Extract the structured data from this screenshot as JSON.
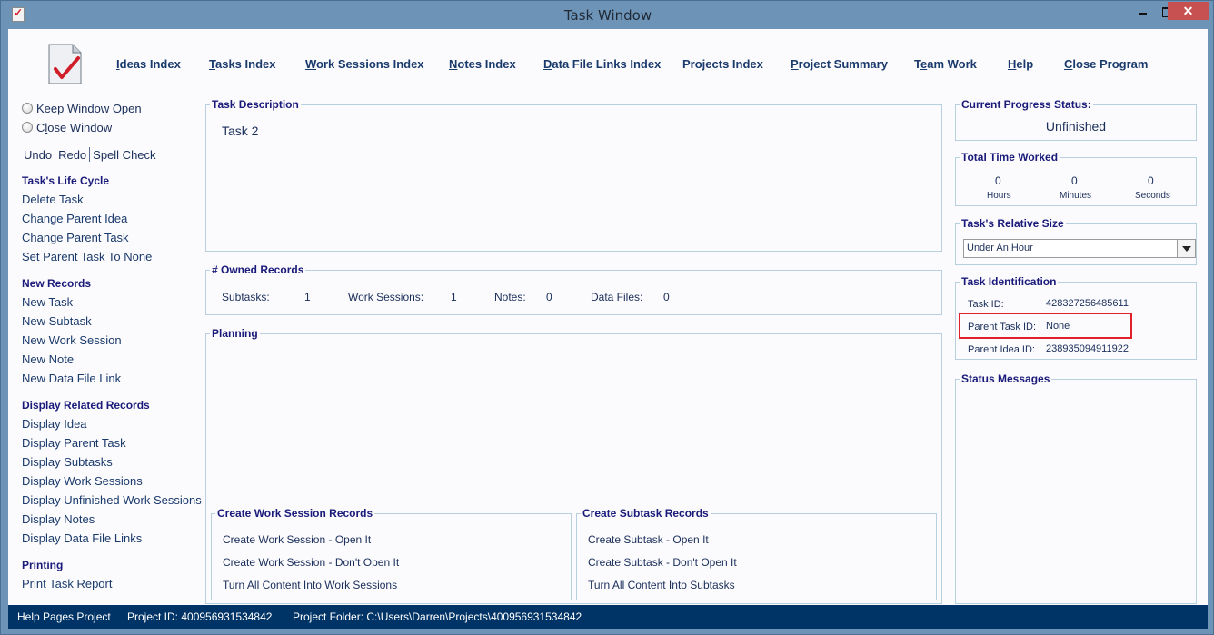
{
  "window": {
    "title": "Task Window",
    "controls": {
      "minimize": "minimize",
      "maximize": "maximize",
      "close": "✕"
    }
  },
  "nav": [
    {
      "label": "Ideas Index",
      "mnemonic": "I",
      "rest": "deas Index"
    },
    {
      "label": "Tasks Index",
      "mnemonic": "T",
      "rest": "asks Index"
    },
    {
      "label": "Work Sessions Index",
      "mnemonic": "W",
      "rest": "ork Sessions Index"
    },
    {
      "label": "Notes Index",
      "mnemonic": "N",
      "rest": "otes Index"
    },
    {
      "label": "Data File Links Index",
      "mnemonic": "D",
      "rest": "ata File Links Index"
    },
    {
      "label": "Projects Index",
      "mnemonic": "",
      "rest": "Projects Index"
    },
    {
      "label": "Project Summary",
      "mnemonic": "P",
      "rest": "roject Summary"
    },
    {
      "label": "Team Work",
      "pre": "T",
      "mnemonic": "e",
      "rest": "am Work"
    },
    {
      "label": "Help",
      "mnemonic": "H",
      "rest": "elp"
    },
    {
      "label": "Close Program",
      "mnemonic": "C",
      "rest": "lose Program"
    }
  ],
  "sidebar": {
    "radios": [
      {
        "pre": "",
        "mnemonic": "K",
        "rest": "eep Window Open",
        "checked": false
      },
      {
        "pre": "C",
        "mnemonic": "l",
        "rest": "ose Window",
        "checked": false
      }
    ],
    "edit": {
      "undo": "Undo",
      "redo": "Redo",
      "spell": "Spell Check"
    },
    "sections": [
      {
        "title": "Task's Life Cycle",
        "items": [
          "Delete Task",
          "Change Parent Idea",
          "Change Parent Task",
          "Set Parent Task To None"
        ]
      },
      {
        "title": "New Records",
        "items": [
          "New Task",
          "New Subtask",
          "New Work Session",
          "New Note",
          "New Data File Link"
        ]
      },
      {
        "title": "Display Related Records",
        "items": [
          "Display Idea",
          "Display Parent Task",
          "Display Subtasks",
          "Display Work Sessions",
          "Display Unfinished Work Sessions",
          "Display Notes",
          "Display Data File Links"
        ]
      },
      {
        "title": "Printing",
        "items": [
          "Print Task Report"
        ]
      }
    ]
  },
  "description": {
    "title": "Task Description",
    "text": "Task 2"
  },
  "owned": {
    "title": "# Owned Records",
    "subtasks_label": "Subtasks:",
    "subtasks": "1",
    "sessions_label": "Work Sessions:",
    "sessions": "1",
    "notes_label": "Notes:",
    "notes": "0",
    "files_label": "Data Files:",
    "files": "0"
  },
  "planning": {
    "title": "Planning",
    "text": ""
  },
  "create_sessions": {
    "title": "Create Work Session Records",
    "items": [
      "Create Work Session - Open It",
      "Create Work Session - Don't Open It",
      "Turn All Content Into Work Sessions"
    ]
  },
  "create_subtasks": {
    "title": "Create Subtask Records",
    "items": [
      "Create Subtask - Open It",
      "Create Subtask - Don't Open It",
      "Turn All Content Into Subtasks"
    ]
  },
  "progress": {
    "title": "Current Progress Status:",
    "value": "Unfinished"
  },
  "time": {
    "title": "Total Time Worked",
    "hours": "0",
    "hours_label": "Hours",
    "minutes": "0",
    "minutes_label": "Minutes",
    "seconds": "0",
    "seconds_label": "Seconds"
  },
  "size": {
    "title": "Task's Relative Size",
    "selected": "Under An Hour"
  },
  "ident": {
    "title": "Task Identification",
    "task_id_label": "Task ID:",
    "task_id": "428327256485611",
    "parent_task_label": "Parent Task ID:",
    "parent_task": "None",
    "parent_idea_label": "Parent Idea ID:",
    "parent_idea": "238935094911922",
    "highlight_color": "#e0202a"
  },
  "messages": {
    "title": "Status Messages"
  },
  "statusbar": {
    "project": "Help Pages Project",
    "project_id": "Project ID:  400956931534842",
    "folder": "Project Folder: C:\\Users\\Darren\\Projects\\400956931534842"
  }
}
